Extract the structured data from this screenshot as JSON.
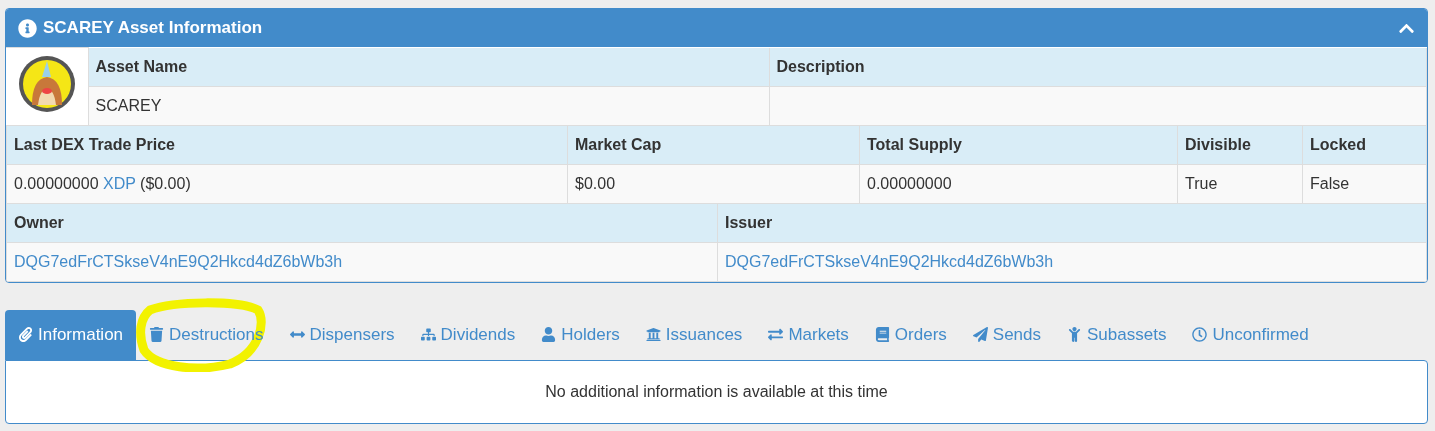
{
  "panel": {
    "title": "SCAREY Asset Information",
    "expanded": true
  },
  "asset": {
    "logo": {
      "kind": "picture"
    },
    "headers": [
      "Asset Name",
      "Description"
    ],
    "values": [
      "SCAREY"
    ]
  },
  "market": {
    "headers": [
      "Last DEX Trade Price",
      "Market Cap",
      "Total Supply",
      "Divisible",
      "Locked"
    ],
    "price": {
      "amount": "0.00000000",
      "currency": "XDP",
      "fiat": "($0.00)"
    },
    "values": [
      "$0.00",
      "0.00000000",
      "True",
      "False"
    ]
  },
  "parties": {
    "headers": [
      "Owner",
      "Issuer"
    ],
    "values": [
      "DQG7edFrCTSkseV4nE9Q2Hkcd4dZ6bWb3h",
      "DQG7edFrCTSkseV4nE9Q2Hkcd4dZ6bWb3h"
    ]
  },
  "tabs": [
    {
      "label": "Information",
      "selected": true,
      "highlighted": false
    },
    {
      "label": "Destructions",
      "selected": false,
      "highlighted": true
    },
    {
      "label": "Dispensers",
      "selected": false,
      "highlighted": false
    },
    {
      "label": "Dividends",
      "selected": false,
      "highlighted": false
    },
    {
      "label": "Holders",
      "selected": false,
      "highlighted": false
    },
    {
      "label": "Issuances",
      "selected": false,
      "highlighted": false
    },
    {
      "label": "Markets",
      "selected": false,
      "highlighted": false
    },
    {
      "label": "Orders",
      "selected": false,
      "highlighted": false
    },
    {
      "label": "Sends",
      "selected": false,
      "highlighted": false
    },
    {
      "label": "Subassets",
      "selected": false,
      "highlighted": false
    },
    {
      "label": "Unconfirmed",
      "selected": false,
      "highlighted": false
    }
  ],
  "tab_content": {
    "message": "No additional information is available at this time"
  }
}
